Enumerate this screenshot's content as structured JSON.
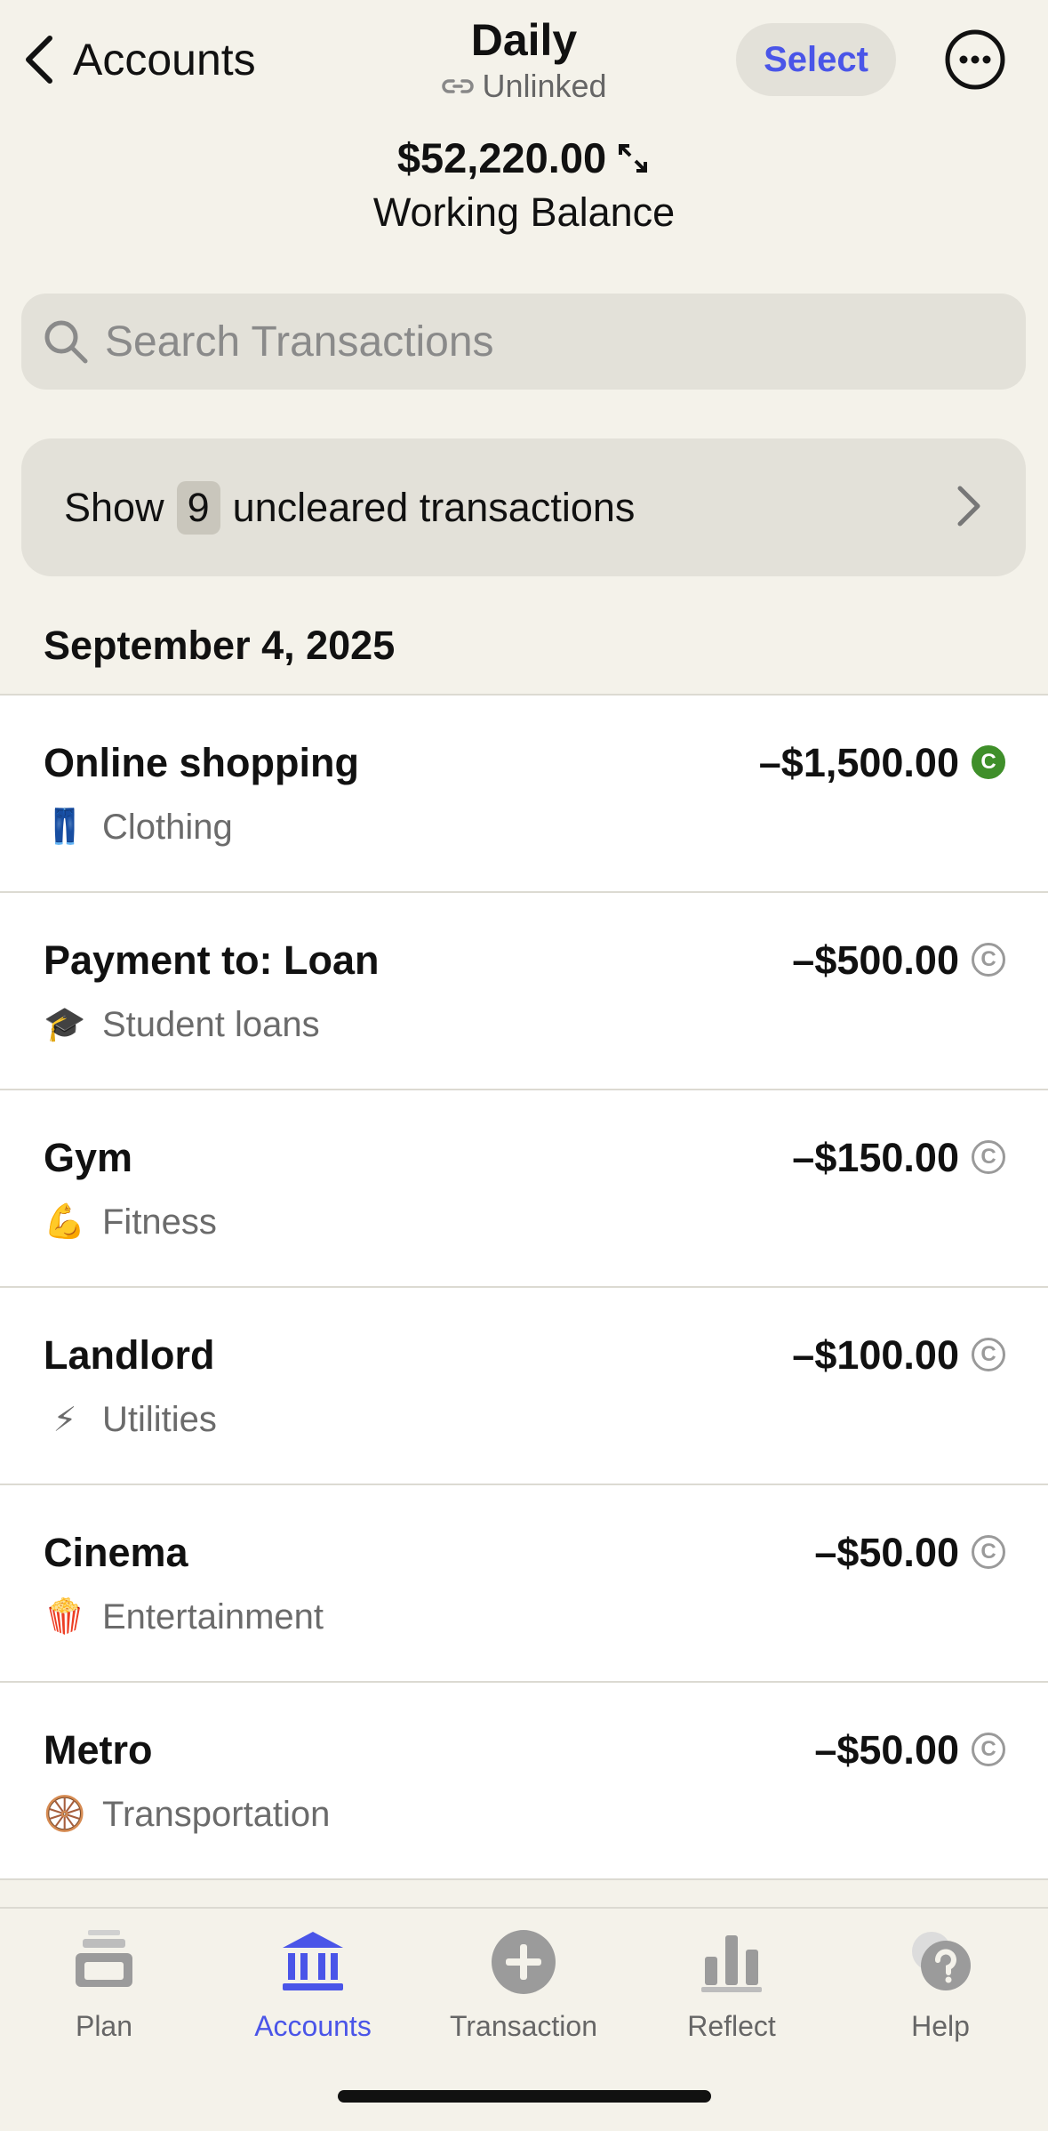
{
  "header": {
    "back_label": "Accounts",
    "title": "Daily",
    "subtitle": "Unlinked",
    "select_label": "Select"
  },
  "balance": {
    "amount": "$52,220.00",
    "label": "Working Balance"
  },
  "search": {
    "placeholder": "Search Transactions"
  },
  "uncleared": {
    "prefix": "Show",
    "count": "9",
    "suffix": "uncleared transactions"
  },
  "date_header": "September 4, 2025",
  "transactions": [
    {
      "payee": "Online shopping",
      "category": "Clothing",
      "emoji": "👖",
      "amount": "–$1,500.00",
      "cleared": true
    },
    {
      "payee": "Payment to: Loan",
      "category": "Student loans",
      "emoji": "🎓",
      "amount": "–$500.00",
      "cleared": false
    },
    {
      "payee": "Gym",
      "category": "Fitness",
      "emoji": "💪",
      "amount": "–$150.00",
      "cleared": false
    },
    {
      "payee": "Landlord",
      "category": "Utilities",
      "emoji": "⚡",
      "amount": "–$100.00",
      "cleared": false
    },
    {
      "payee": "Cinema",
      "category": "Entertainment",
      "emoji": "🍿",
      "amount": "–$50.00",
      "cleared": false
    },
    {
      "payee": "Metro",
      "category": "Transportation",
      "emoji": "🛞",
      "amount": "–$50.00",
      "cleared": false
    }
  ],
  "cleared_glyph": "C",
  "tabs": [
    {
      "label": "Plan",
      "icon": "plan-icon"
    },
    {
      "label": "Accounts",
      "icon": "bank-icon",
      "active": true
    },
    {
      "label": "Transaction",
      "icon": "add-circle-icon"
    },
    {
      "label": "Reflect",
      "icon": "bar-chart-icon"
    },
    {
      "label": "Help",
      "icon": "help-bubble-icon"
    }
  ],
  "colors": {
    "accent": "#4a55e8",
    "cleared_green": "#3f8f2a",
    "background": "#f4f2ea"
  }
}
